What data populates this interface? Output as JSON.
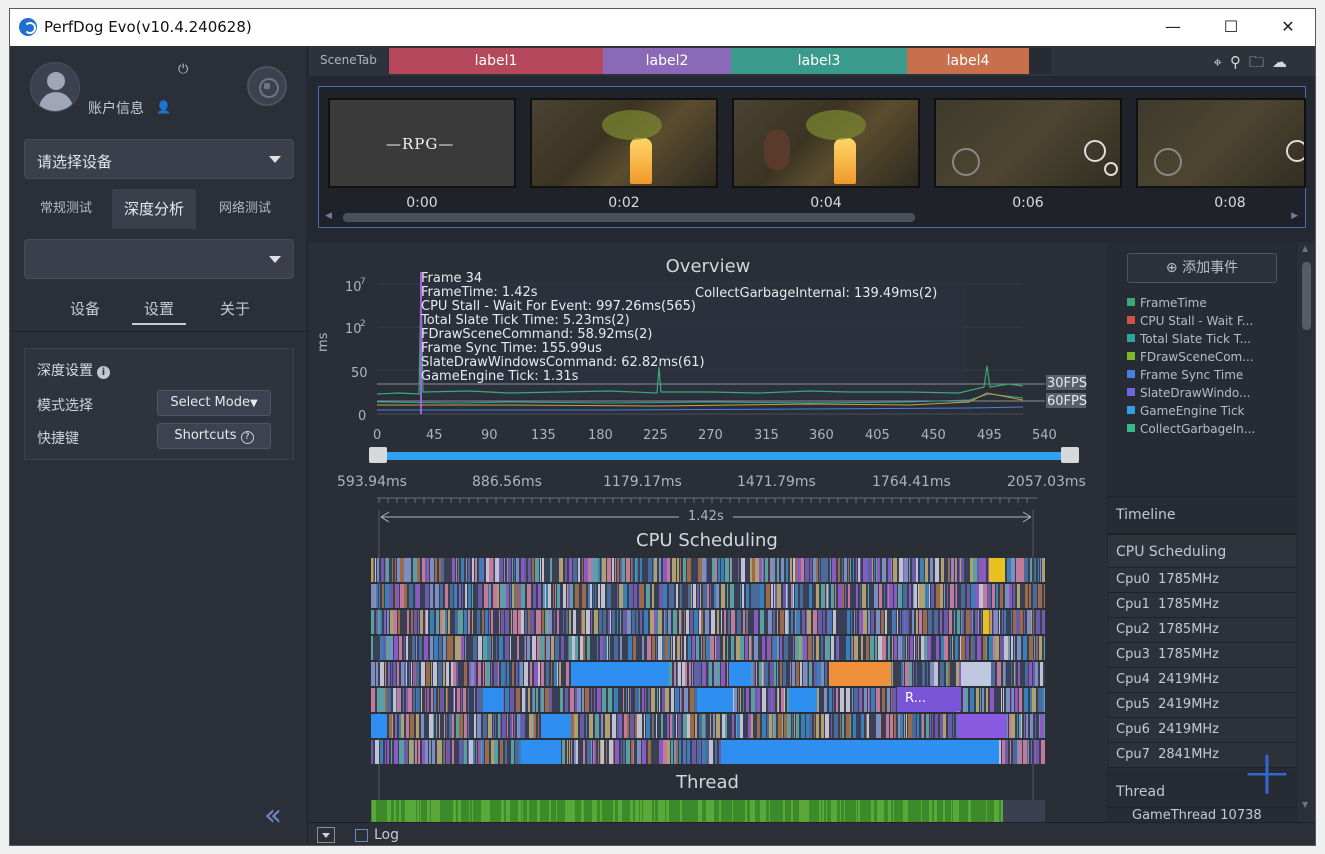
{
  "window": {
    "title": "PerfDog Evo(v10.4.240628)",
    "minimize": "—",
    "maximize": "☐",
    "close": "✕"
  },
  "left": {
    "account_label": "账户信息",
    "device_select": "请选择设备",
    "mode_tabs": [
      "常规测试",
      "深度分析",
      "网络测试"
    ],
    "active_mode_tab": 1,
    "sub_tabs": [
      "设备",
      "设置",
      "关于"
    ],
    "active_sub_tab": 1,
    "settings": {
      "header": "深度设置",
      "mode_label": "模式选择",
      "mode_button": "Select Mode",
      "shortcut_label": "快捷键",
      "shortcut_button": "Shortcuts"
    }
  },
  "scenebar": {
    "label": "SceneTab",
    "tabs": [
      {
        "label": "label1",
        "color": "#b5485a"
      },
      {
        "label": "label2",
        "color": "#8a6ab8"
      },
      {
        "label": "label3",
        "color": "#3a9a8c"
      },
      {
        "label": "label4",
        "color": "#c8704e"
      }
    ],
    "icons": [
      "map-pin-icon",
      "pin-outline-icon",
      "folder-icon",
      "cloud-icon"
    ]
  },
  "thumbnails": {
    "times": [
      "0:00",
      "0:02",
      "0:04",
      "0:06",
      "0:08"
    ],
    "first_logo": "RPG"
  },
  "overview": {
    "title": "Overview",
    "y_unit": "ms",
    "y_ticks": [
      "10⁷",
      "10²",
      "50",
      "0"
    ],
    "x_ticks": [
      "0",
      "45",
      "90",
      "135",
      "180",
      "225",
      "270",
      "315",
      "360",
      "405",
      "450",
      "495",
      "540"
    ],
    "fps_tags": [
      "30FPS",
      "60FPS"
    ],
    "tooltip": [
      "Frame 34",
      "FrameTime: 1.42s",
      "CPU Stall - Wait For Event: 997.26ms(565)",
      "Total Slate Tick Time: 5.23ms(2)",
      "FDrawSceneCommand: 58.92ms(2)",
      "Frame Sync Time: 155.99us",
      "SlateDrawWindowsCommand: 62.82ms(61)",
      "GameEngine Tick: 1.31s"
    ],
    "tooltip_right": "CollectGarbageInternal: 139.49ms(2)"
  },
  "ruler": {
    "labels": [
      "593.94ms",
      "886.56ms",
      "1179.17ms",
      "1471.79ms",
      "1764.41ms",
      "2057.03ms"
    ],
    "span": "1.42s"
  },
  "sections": {
    "cpu": "CPU Scheduling",
    "thread": "Thread",
    "chip_label": "R..."
  },
  "sidebar": {
    "add_event": "添加事件",
    "legend": [
      {
        "label": "FrameTime",
        "color": "#3aa876"
      },
      {
        "label": "CPU Stall - Wait F...",
        "color": "#d0524a"
      },
      {
        "label": "Total Slate Tick T...",
        "color": "#2aa5a0"
      },
      {
        "label": "FDrawSceneCom...",
        "color": "#7cb82e"
      },
      {
        "label": "Frame Sync Time",
        "color": "#4a7fe0"
      },
      {
        "label": "SlateDrawWindo...",
        "color": "#6a6ae0"
      },
      {
        "label": "GameEngine Tick",
        "color": "#2fa0e0"
      },
      {
        "label": "CollectGarbageIn...",
        "color": "#3ab88a"
      }
    ],
    "timeline": "Timeline",
    "cpu_header": "CPU Scheduling",
    "cpus": [
      {
        "name": "Cpu0",
        "freq": "1785MHz"
      },
      {
        "name": "Cpu1",
        "freq": "1785MHz"
      },
      {
        "name": "Cpu2",
        "freq": "1785MHz"
      },
      {
        "name": "Cpu3",
        "freq": "1785MHz"
      },
      {
        "name": "Cpu4",
        "freq": "2419MHz"
      },
      {
        "name": "Cpu5",
        "freq": "2419MHz"
      },
      {
        "name": "Cpu6",
        "freq": "2419MHz"
      },
      {
        "name": "Cpu7",
        "freq": "2841MHz"
      }
    ],
    "thread_header": "Thread",
    "thread_item": "GameThread 10738"
  },
  "bottom": {
    "log_label": "Log"
  }
}
